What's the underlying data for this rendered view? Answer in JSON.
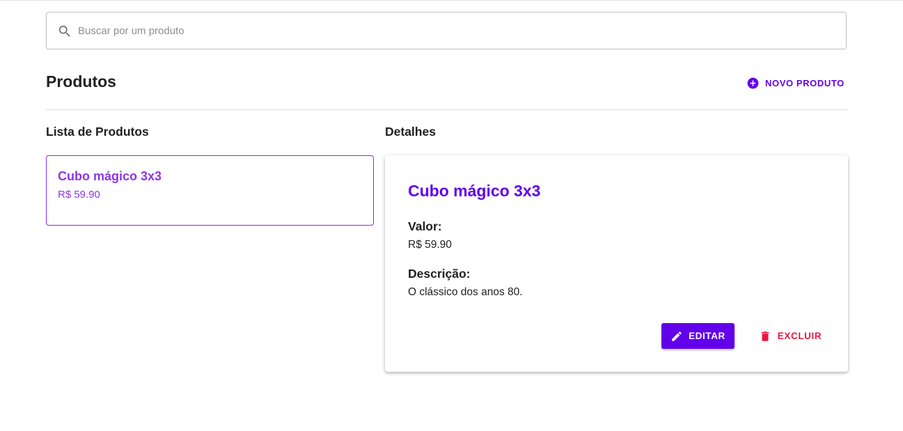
{
  "search": {
    "placeholder": "Buscar por um produto",
    "value": "",
    "icon": "search-icon"
  },
  "header": {
    "title": "Produtos",
    "new_product_label": "NOVO PRODUTO",
    "new_product_icon": "add-circle-icon"
  },
  "list": {
    "title": "Lista de Produtos",
    "items": [
      {
        "name": "Cubo mágico 3x3",
        "price": "R$ 59.90"
      }
    ]
  },
  "details": {
    "title": "Detalhes",
    "name": "Cubo mágico 3x3",
    "value_label": "Valor:",
    "value": "R$ 59.90",
    "description_label": "Descrição:",
    "description": "O clássico dos anos 80.",
    "edit_label": "EDITAR",
    "edit_icon": "pencil-icon",
    "delete_label": "EXCLUIR",
    "delete_icon": "trash-icon"
  },
  "colors": {
    "primary": "#6200ea",
    "list_accent": "#8e35e8",
    "danger": "#e8173f"
  }
}
